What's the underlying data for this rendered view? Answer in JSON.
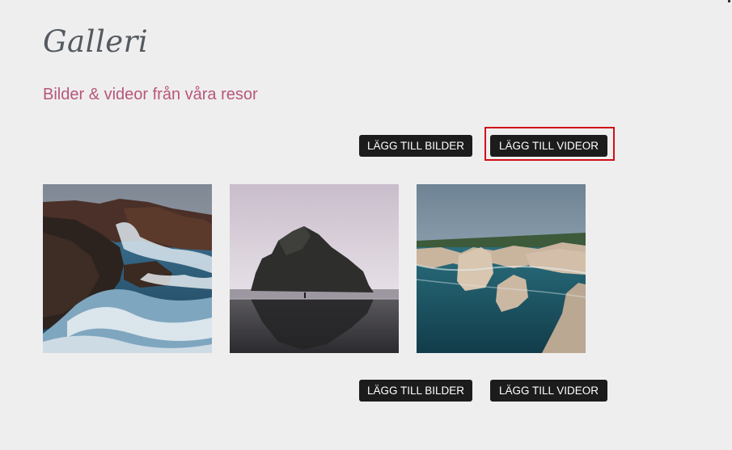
{
  "gallery": {
    "title": "Galleri",
    "subtitle": "Bilder & videor från våra resor"
  },
  "actions": {
    "add_images_label": "LÄGG TILL BILDER",
    "add_videos_label": "LÄGG TILL VIDEOR"
  },
  "photos": [
    {
      "subject": "waves crashing against dark coastal cliffs"
    },
    {
      "subject": "lone sea stack on a reflective misty beach"
    },
    {
      "subject": "sandstone cliffs above a turquoise cove"
    }
  ],
  "colors": {
    "background": "#efeeef",
    "title": "#555a60",
    "subtitle_accent": "#b7577a",
    "button_bg": "#1c1c1c",
    "button_text": "#ffffff",
    "highlight": "#d10e17"
  }
}
